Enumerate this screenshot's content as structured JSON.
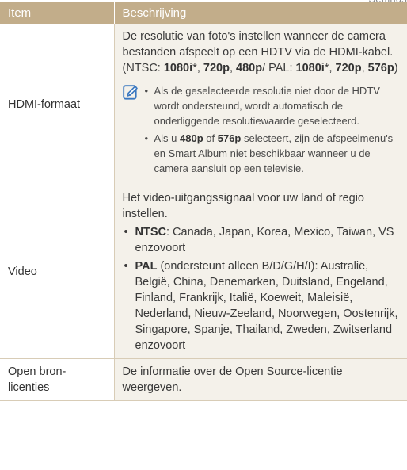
{
  "table": {
    "header_item": "Item",
    "header_desc": "Beschrijving"
  },
  "rows": {
    "hdmi": {
      "label": "HDMI-formaat",
      "p1": "De resolutie van foto's instellen wanneer de camera bestanden afspeelt op een HDTV via de HDMI-kabel. (NTSC: ",
      "ntsc_1080": "1080i",
      "star": "*",
      "sep": ", ",
      "r720": "720p",
      "r480": "480p",
      "slash_pal": "/ PAL: ",
      "pal_1080": "1080i",
      "r720b": "720p",
      "r576": "576p",
      "close": ")",
      "note_icon": "note-pencil-icon",
      "note1": "Als de geselecteerde resolutie niet door de HDTV wordt ondersteund, wordt automatisch de onderliggende resolutiewaarde geselecteerd.",
      "note2_a": "Als u ",
      "note2_480": "480p",
      "note2_of": " of ",
      "note2_576": "576p",
      "note2_b": " selecteert, zijn de afspeelmenu's en Smart Album niet beschikbaar wanneer u de camera aansluit op een televisie."
    },
    "video": {
      "label": "Video",
      "intro": "Het video-uitgangssignaal voor uw land of regio instellen.",
      "ntsc": "NTSC",
      "ntsc_text": ": Canada, Japan, Korea, Mexico, Taiwan, VS enzovoort",
      "pal": "PAL",
      "pal_text": " (ondersteunt alleen B/D/G/H/I): Australië, België, China, Denemarken, Duitsland, Engeland, Finland, Frankrijk, Italië, Koeweit, Maleisië, Nederland, Nieuw-Zeeland, Noorwegen, Oostenrijk, Singapore, Spanje, Thailand, Zweden, Zwitserland enzovoort"
    },
    "license": {
      "label": "Open bron-licenties",
      "desc": "De informatie over de Open Source-licentie weergeven."
    }
  },
  "colors": {
    "header_bg": "#c2ad8a",
    "desc_bg": "#f4f1ea",
    "note_icon": "#3b78c0"
  }
}
